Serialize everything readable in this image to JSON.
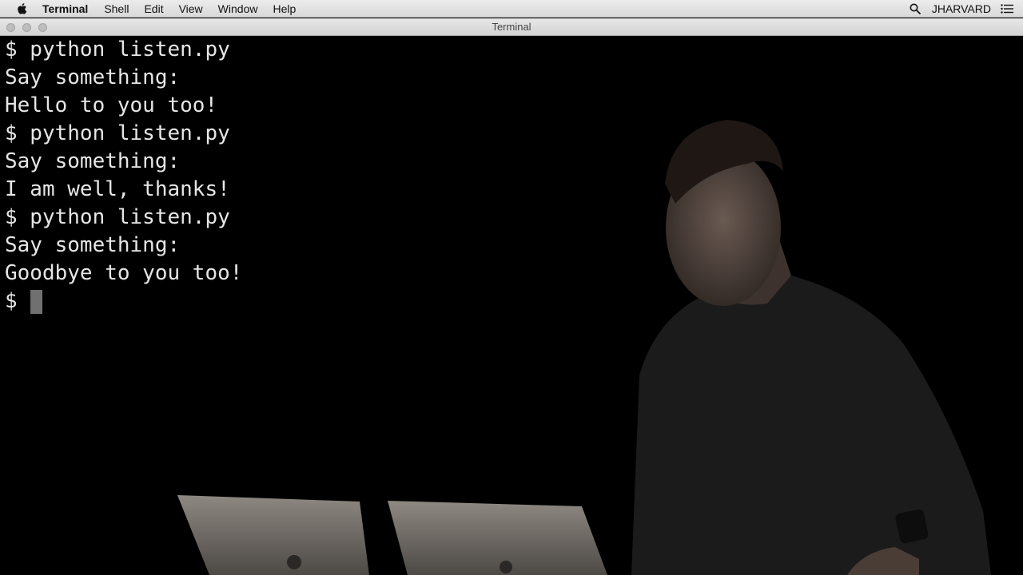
{
  "menubar": {
    "app_name": "Terminal",
    "items": [
      "Shell",
      "Edit",
      "View",
      "Window",
      "Help"
    ],
    "user": "JHARVARD"
  },
  "window": {
    "title": "Terminal"
  },
  "terminal": {
    "lines": [
      "$ python listen.py",
      "Say something:",
      "Hello to you too!",
      "$ python listen.py",
      "Say something:",
      "I am well, thanks!",
      "$ python listen.py",
      "Say something:",
      "Goodbye to you too!"
    ],
    "prompt": "$"
  },
  "icons": {
    "apple": "apple-logo-icon",
    "search": "spotlight-search-icon",
    "menu": "notification-list-icon",
    "cursor": "block-cursor"
  },
  "colors": {
    "terminal_bg": "#000000",
    "terminal_text": "#e6e6e6",
    "cursor": "#707070",
    "menubar_bg": "#e2e2e2"
  }
}
